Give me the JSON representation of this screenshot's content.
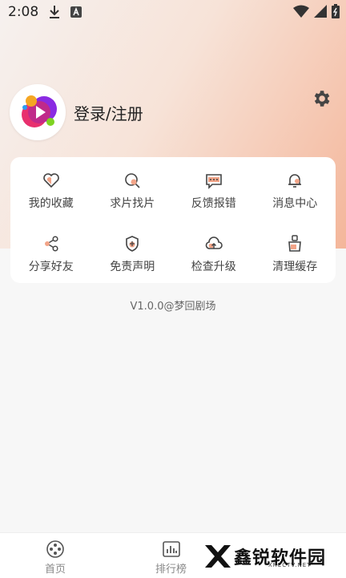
{
  "status": {
    "time": "2:08"
  },
  "profile": {
    "login_text": "登录/注册"
  },
  "menu": [
    {
      "label": "我的收藏",
      "icon": "heart-icon"
    },
    {
      "label": "求片找片",
      "icon": "search-film-icon"
    },
    {
      "label": "反馈报错",
      "icon": "feedback-icon"
    },
    {
      "label": "消息中心",
      "icon": "bell-icon"
    },
    {
      "label": "分享好友",
      "icon": "share-icon"
    },
    {
      "label": "免责声明",
      "icon": "shield-icon"
    },
    {
      "label": "检查升级",
      "icon": "cloud-upload-icon"
    },
    {
      "label": "清理缓存",
      "icon": "broom-icon"
    }
  ],
  "version_text": "V1.0.0@梦回剧场",
  "bottom_nav": [
    {
      "label": "首页",
      "icon": "film-reel-icon"
    },
    {
      "label": "排行榜",
      "icon": "chart-icon"
    }
  ],
  "watermark": {
    "text": "鑫锐软件园",
    "sub": "XRCCTV.NET"
  },
  "colors": {
    "accent": "#f4a07c",
    "icon_fill": "#f2a488"
  }
}
